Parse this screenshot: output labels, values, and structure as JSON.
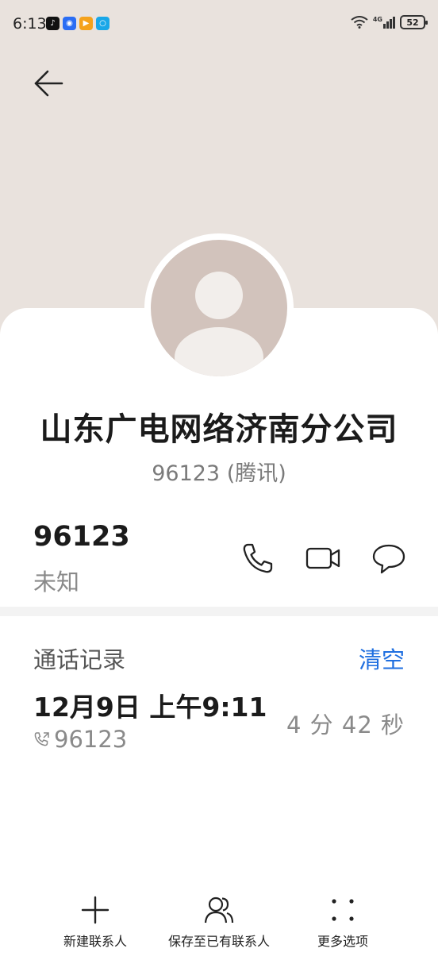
{
  "status_bar": {
    "time": "6:13",
    "network": "4G",
    "battery": "52"
  },
  "contact": {
    "name": "山东广电网络济南分公司",
    "subtitle": "96123 (腾讯)"
  },
  "number_row": {
    "number": "96123",
    "label": "未知",
    "icons": [
      "phone-icon",
      "video-call-icon",
      "message-icon"
    ]
  },
  "call_log": {
    "title": "通话记录",
    "clear_label": "清空",
    "entries": [
      {
        "date": "12月9日 上午9:11",
        "number": "96123",
        "duration": "4 分 42 秒"
      }
    ]
  },
  "bottom_nav": {
    "new_contact": "新建联系人",
    "save_existing": "保存至已有联系人",
    "more_options": "更多选项"
  },
  "colors": {
    "header_bg": "#e9e2dd",
    "avatar_bg": "#d2c3bc",
    "accent": "#1f6fe0"
  }
}
